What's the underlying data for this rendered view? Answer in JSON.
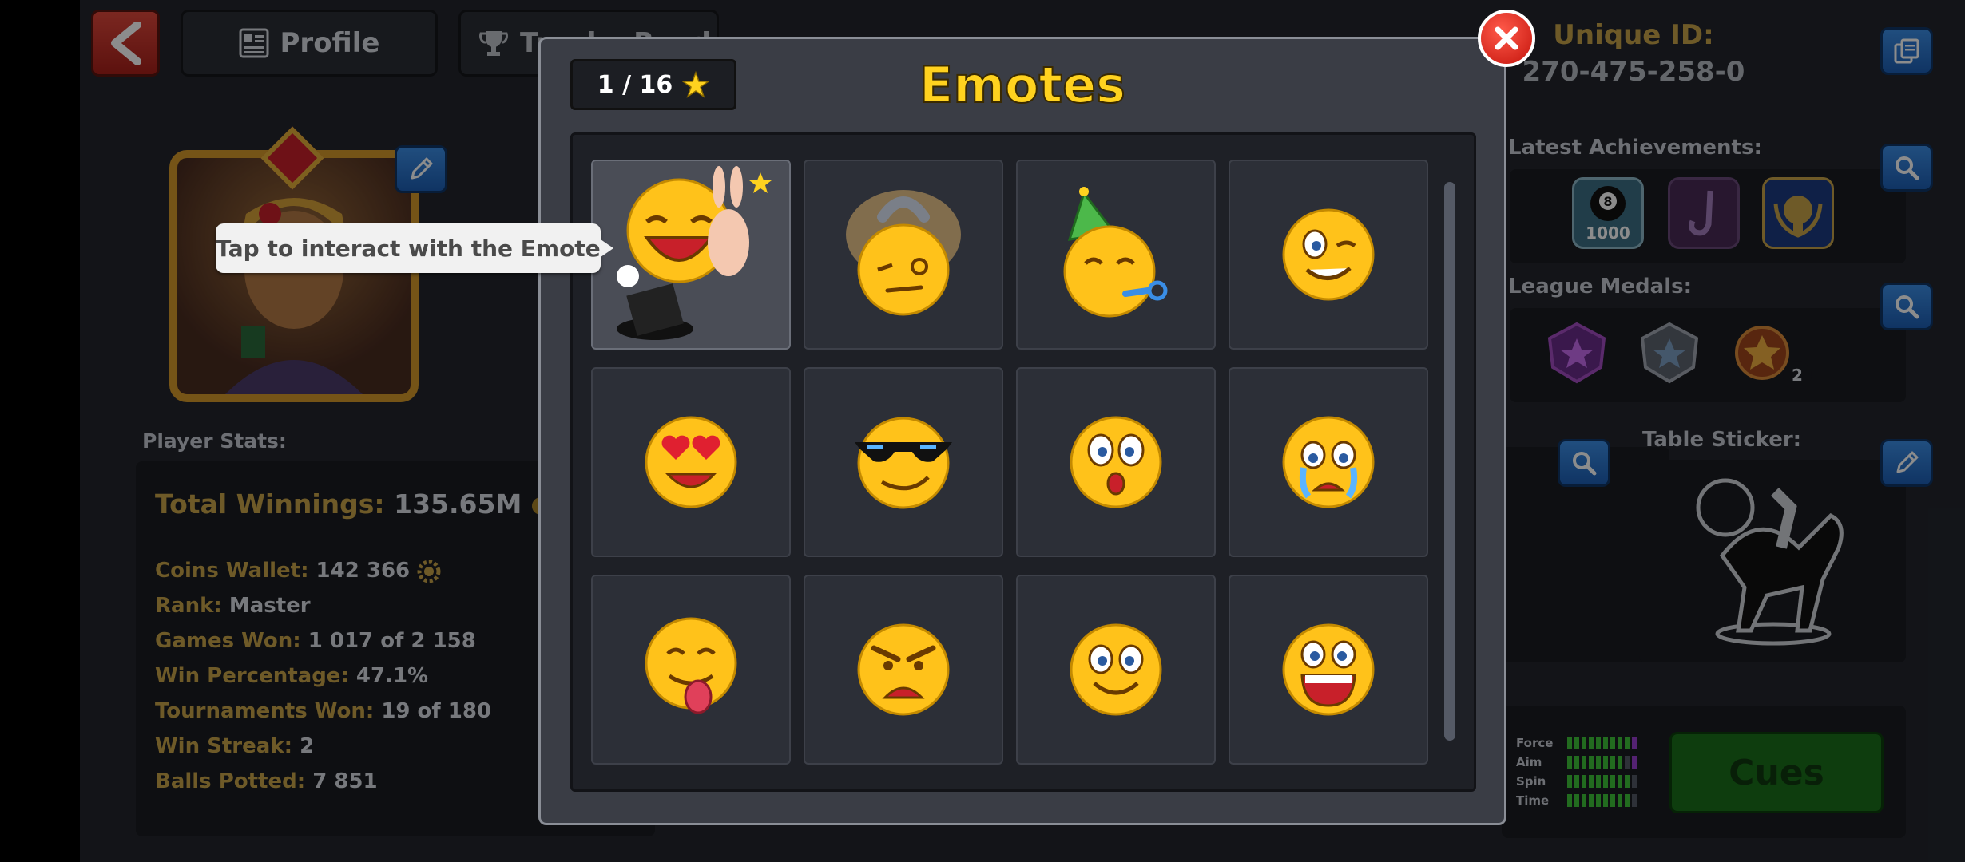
{
  "header": {
    "tabs": [
      {
        "label": "Profile"
      },
      {
        "label": "Trophy Road"
      }
    ],
    "unique_id_label": "Unique ID:",
    "unique_id_value": "270-475-258-0"
  },
  "right": {
    "latest_achievements_label": "Latest Achievements:",
    "league_medals_label": "League Medals:",
    "medal_count": "2",
    "table_sticker_label": "Table Sticker:",
    "meters": [
      {
        "label": "Force",
        "level": 10
      },
      {
        "label": "Aim",
        "level": 8
      },
      {
        "label": "Spin",
        "level": 9
      },
      {
        "label": "Time",
        "level": 9
      }
    ],
    "cues_label": "Cues",
    "achievement_1_text": "1000"
  },
  "player_stats": {
    "label": "Player Stats:",
    "total_winnings_key": "Total Winnings:",
    "total_winnings_value": "135.65M",
    "rows": [
      {
        "key": "Coins Wallet:",
        "value": "142 366"
      },
      {
        "key": "Rank:",
        "value": "Master"
      },
      {
        "key": "Games Won:",
        "value": "1 017 of 2 158"
      },
      {
        "key": "Win Percentage:",
        "value": "47.1%"
      },
      {
        "key": "Tournaments Won:",
        "value": "19 of 180"
      },
      {
        "key": "Win Streak:",
        "value": "2"
      },
      {
        "key": "Balls Potted:",
        "value": "7 851"
      }
    ]
  },
  "modal": {
    "title": "Emotes",
    "counter": "1 / 16",
    "tooltip": "Tap to interact with the Emote",
    "emotes": [
      "magician-laugh",
      "dizzy-horseshoe",
      "party",
      "wink",
      "heart-eyes",
      "sunglasses",
      "surprised",
      "crying",
      "tongue-out",
      "angry",
      "smile",
      "laughing"
    ]
  },
  "colors": {
    "gold": "#c9a54a",
    "title_yellow": "#ffd21f",
    "button_blue": "#2a76d2",
    "close_red": "#d0201a",
    "cues_green": "#1a6f1a"
  }
}
